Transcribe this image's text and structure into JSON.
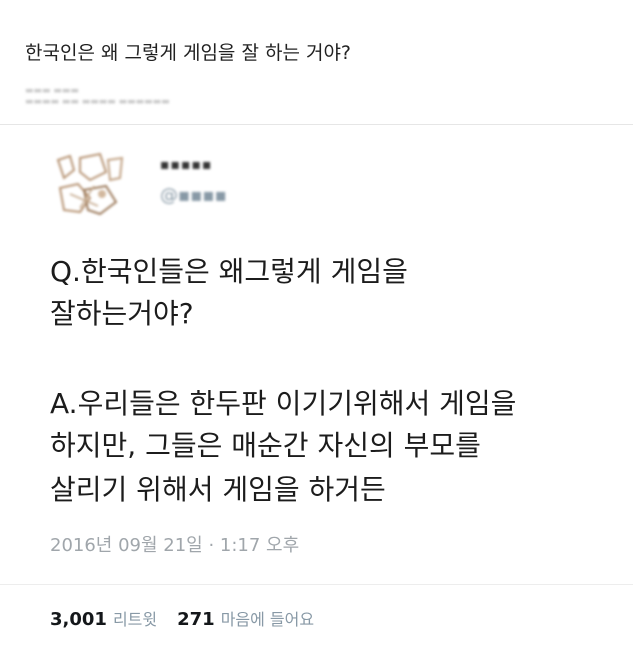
{
  "post": {
    "title": "한국인은 왜 그렇게 게임을 잘 하는 거야?"
  },
  "tweet": {
    "lines": [
      "Q.한국인들은 왜그렇게 게임을",
      "잘하는거야?",
      "A.우리들은 한두판 이기기위해서 게임을",
      "하지만, 그들은 매순간 자신의 부모를",
      "살리기 위해서 게임을 하거든"
    ],
    "timestamp": "2016년 09월 21일 · 1:17 오후",
    "retweets_count": "3,001",
    "retweets_label": "리트윗",
    "likes_count": "271",
    "likes_label": "마음에 들어요"
  }
}
